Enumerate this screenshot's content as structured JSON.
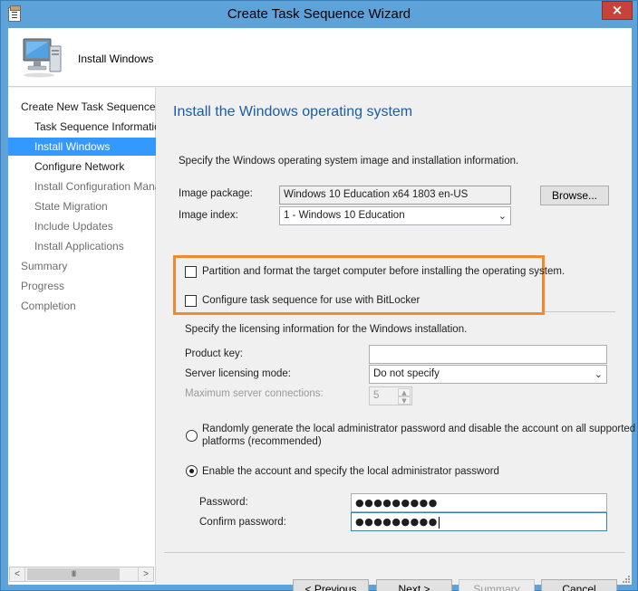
{
  "window": {
    "title": "Create Task Sequence Wizard",
    "close_glyph": "×"
  },
  "header": {
    "title": "Install Windows",
    "icon": "computer-icon"
  },
  "nav": {
    "items": [
      {
        "label": "Create New Task Sequence",
        "state": "normal"
      },
      {
        "label": "Task Sequence Information",
        "state": "normal"
      },
      {
        "label": "Install Windows",
        "state": "active"
      },
      {
        "label": "Configure Network",
        "state": "normal"
      },
      {
        "label": "Install Configuration Manager",
        "state": "disabled"
      },
      {
        "label": "State Migration",
        "state": "disabled"
      },
      {
        "label": "Include Updates",
        "state": "disabled"
      },
      {
        "label": "Install Applications",
        "state": "disabled"
      },
      {
        "label": "Summary",
        "state": "disabled"
      },
      {
        "label": "Progress",
        "state": "disabled"
      },
      {
        "label": "Completion",
        "state": "disabled"
      }
    ],
    "scroll_left": "<",
    "scroll_right": ">",
    "scroll_thumb": "III"
  },
  "main": {
    "title": "Install the Windows operating system",
    "description": "Specify the Windows operating system image and installation information.",
    "image_package_label": "Image package:",
    "image_package_value": "Windows 10 Education x64 1803 en-US",
    "browse_label": "Browse...",
    "image_index_label": "Image index:",
    "image_index_value": "1 - Windows 10 Education",
    "partition_label": "Partition and format the target computer before installing the operating system.",
    "partition_checked": false,
    "bitlocker_label": "Configure task sequence for use with BitLocker",
    "bitlocker_checked": false,
    "licensing_text": "Specify the licensing information for the Windows installation.",
    "product_key_label": "Product key:",
    "product_key_value": "",
    "server_licensing_label": "Server licensing mode:",
    "server_licensing_value": "Do not specify",
    "max_connections_label": "Maximum server connections:",
    "max_connections_value": "5",
    "random_password_label_line1": "Randomly generate the local administrator password and disable the account on all supported",
    "random_password_label_line2": "platforms (recommended)",
    "enable_account_label": "Enable the account and specify the local administrator password",
    "selected_option": "enable_account",
    "password_label": "Password:",
    "password_value": "●●●●●●●●●",
    "confirm_password_label": "Confirm password:",
    "confirm_password_value": "●●●●●●●●●"
  },
  "footer": {
    "previous_label": "< Previous",
    "next_label": "Next >",
    "summary_label": "Summary",
    "cancel_label": "Cancel"
  },
  "colors": {
    "title_bar": "#5ea2da",
    "accent_selection": "#3399ff",
    "page_title": "#1a5ca8",
    "highlight_box": "#f28a2c",
    "close_button": "#c7423a"
  }
}
